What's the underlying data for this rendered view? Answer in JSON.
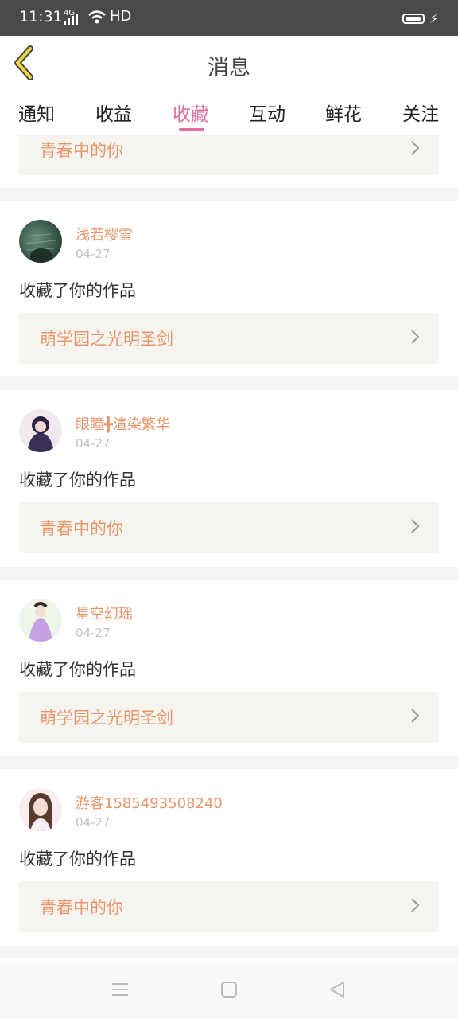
{
  "status": {
    "time": "11:31",
    "network": "4G",
    "hd": "HD"
  },
  "header": {
    "title": "消息"
  },
  "tabs": [
    {
      "label": "通知"
    },
    {
      "label": "收益"
    },
    {
      "label": "收藏",
      "active": true
    },
    {
      "label": "互动"
    },
    {
      "label": "鲜花"
    },
    {
      "label": "关注"
    }
  ],
  "top_partial_item": {
    "work_title": "青春中的你"
  },
  "items": [
    {
      "user": "浅若樱雪",
      "date": "04-27",
      "message": "收藏了你的作品",
      "work_title": "萌学园之光明圣剑"
    },
    {
      "user": "眼瞳╋渲染繁华",
      "date": "04-27",
      "message": "收藏了你的作品",
      "work_title": "青春中的你"
    },
    {
      "user": "星空幻瑶",
      "date": "04-27",
      "message": "收藏了你的作品",
      "work_title": "萌学园之光明圣剑"
    },
    {
      "user": "游客1585493508240",
      "date": "04-27",
      "message": "收藏了你的作品",
      "work_title": "青春中的你"
    }
  ],
  "colors": {
    "accent": "#e06ea2",
    "link": "#e7966b",
    "card_bg": "#f5f4ee",
    "back_arrow": "#f0d540"
  }
}
